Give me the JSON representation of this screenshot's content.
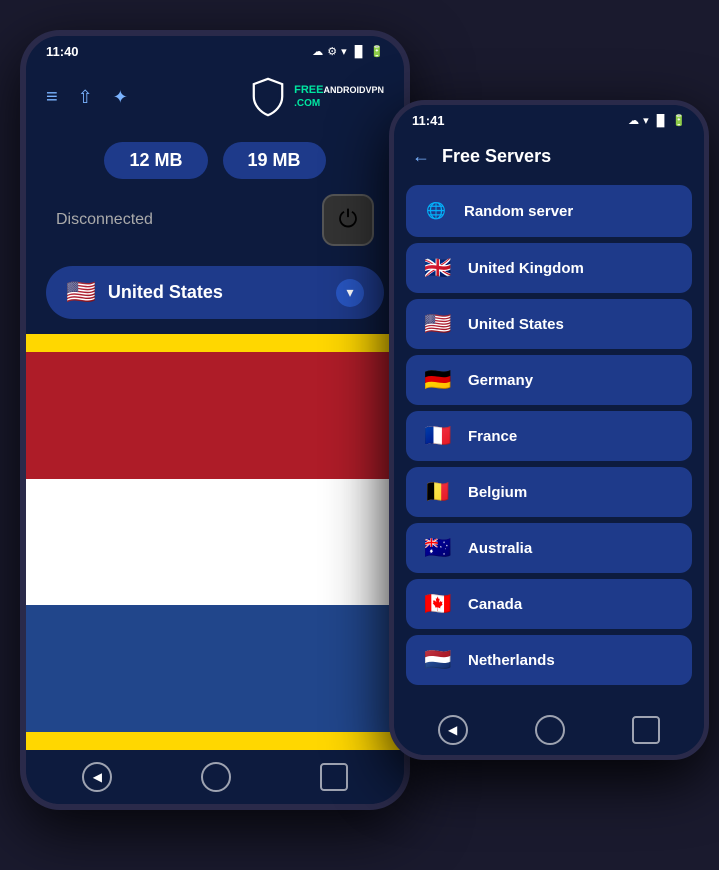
{
  "phone1": {
    "status_bar": {
      "time": "11:40",
      "icons": [
        "☁",
        "⚙",
        "▲"
      ]
    },
    "nav": {
      "menu_icon": "≡",
      "share_icon": "⇧",
      "favorite_icon": "★"
    },
    "brand": {
      "text_line1": "FREEANDROIDVPN",
      "text_line2": ".COM"
    },
    "stats": {
      "download": "12 MB",
      "upload": "19 MB"
    },
    "status": {
      "connection": "Disconnected"
    },
    "selected_country": {
      "name": "United States",
      "flag": "🇺🇸"
    },
    "bottom_nav": {
      "back": "◀",
      "home": "",
      "recent": ""
    }
  },
  "phone2": {
    "status_bar": {
      "time": "11:41",
      "icons": [
        "☁",
        "▲"
      ]
    },
    "header": {
      "back": "←",
      "title": "Free Servers"
    },
    "servers": [
      {
        "name": "Random server",
        "flag": "🌐",
        "type": "globe"
      },
      {
        "name": "United Kingdom",
        "flag": "🇬🇧",
        "type": "flag"
      },
      {
        "name": "United States",
        "flag": "🇺🇸",
        "type": "flag"
      },
      {
        "name": "Germany",
        "flag": "🇩🇪",
        "type": "flag"
      },
      {
        "name": "France",
        "flag": "🇫🇷",
        "type": "flag"
      },
      {
        "name": "Belgium",
        "flag": "🇧🇪",
        "type": "flag"
      },
      {
        "name": "Australia",
        "flag": "🇦🇺",
        "type": "flag"
      },
      {
        "name": "Canada",
        "flag": "🇨🇦",
        "type": "flag"
      },
      {
        "name": "Netherlands",
        "flag": "🇳🇱",
        "type": "flag"
      }
    ],
    "bottom_nav": {
      "back": "◀",
      "home": "",
      "recent": ""
    }
  }
}
